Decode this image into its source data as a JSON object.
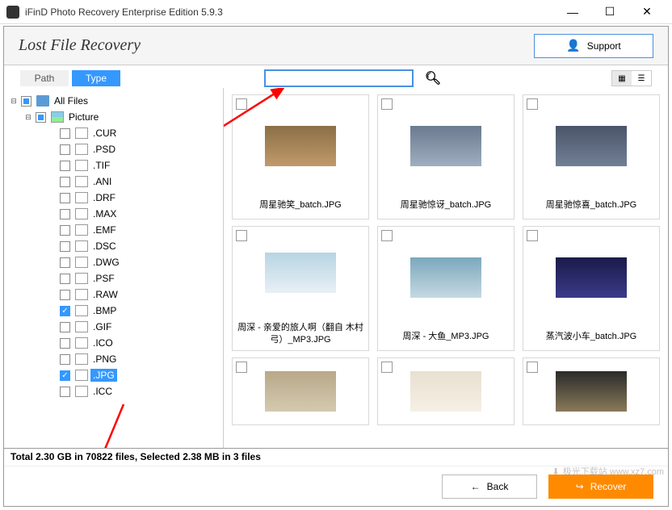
{
  "window": {
    "title": "iFinD Photo Recovery Enterprise Edition 5.9.3"
  },
  "header": {
    "title": "Lost File Recovery",
    "support": "Support"
  },
  "tabs": {
    "path": "Path",
    "type": "Type"
  },
  "search": {
    "placeholder": ""
  },
  "tree": {
    "root": "All Files",
    "picture": "Picture",
    "exts": [
      ".CUR",
      ".PSD",
      ".TIF",
      ".ANI",
      ".DRF",
      ".MAX",
      ".EMF",
      ".DSC",
      ".DWG",
      ".PSF",
      ".RAW",
      ".BMP",
      ".GIF",
      ".ICO",
      ".PNG",
      ".JPG",
      ".ICC"
    ]
  },
  "thumbs": [
    {
      "name": "周星驰笑_batch.JPG"
    },
    {
      "name": "周星驰惊讶_batch.JPG"
    },
    {
      "name": "周星驰惊喜_batch.JPG"
    },
    {
      "name": "周深 - 亲爱的旅人啊（翻自 木村弓）_MP3.JPG"
    },
    {
      "name": "周深 - 大鱼_MP3.JPG"
    },
    {
      "name": "蒸汽波小车_batch.JPG"
    },
    {
      "name": ""
    },
    {
      "name": ""
    },
    {
      "name": ""
    }
  ],
  "status": "Total 2.30 GB in 70822 files,  Selected 2.38 MB in 3 files",
  "footer": {
    "back": "Back",
    "recover": "Recover"
  },
  "watermark": "极光下载站 www.xz7.com"
}
